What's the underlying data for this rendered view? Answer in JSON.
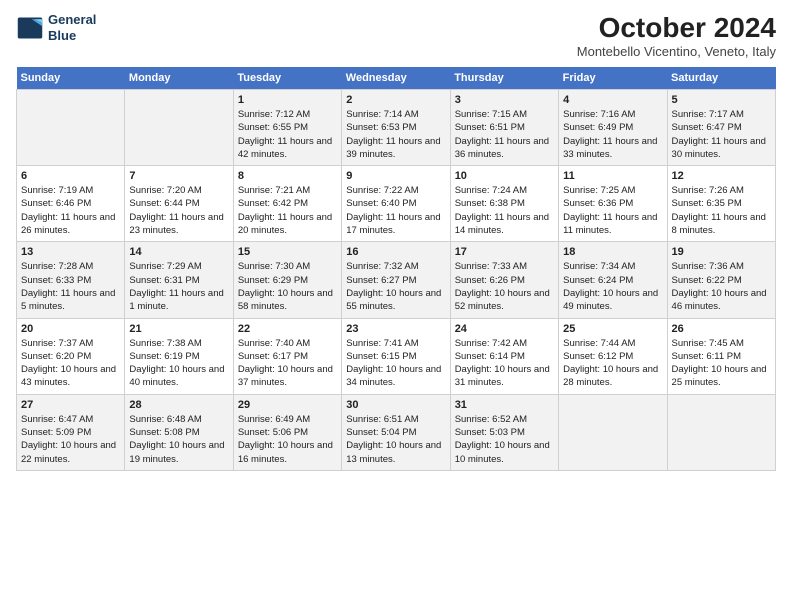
{
  "header": {
    "logo_line1": "General",
    "logo_line2": "Blue",
    "month": "October 2024",
    "location": "Montebello Vicentino, Veneto, Italy"
  },
  "days_of_week": [
    "Sunday",
    "Monday",
    "Tuesday",
    "Wednesday",
    "Thursday",
    "Friday",
    "Saturday"
  ],
  "weeks": [
    [
      {
        "day": "",
        "sunrise": "",
        "sunset": "",
        "daylight": ""
      },
      {
        "day": "",
        "sunrise": "",
        "sunset": "",
        "daylight": ""
      },
      {
        "day": "1",
        "sunrise": "Sunrise: 7:12 AM",
        "sunset": "Sunset: 6:55 PM",
        "daylight": "Daylight: 11 hours and 42 minutes."
      },
      {
        "day": "2",
        "sunrise": "Sunrise: 7:14 AM",
        "sunset": "Sunset: 6:53 PM",
        "daylight": "Daylight: 11 hours and 39 minutes."
      },
      {
        "day": "3",
        "sunrise": "Sunrise: 7:15 AM",
        "sunset": "Sunset: 6:51 PM",
        "daylight": "Daylight: 11 hours and 36 minutes."
      },
      {
        "day": "4",
        "sunrise": "Sunrise: 7:16 AM",
        "sunset": "Sunset: 6:49 PM",
        "daylight": "Daylight: 11 hours and 33 minutes."
      },
      {
        "day": "5",
        "sunrise": "Sunrise: 7:17 AM",
        "sunset": "Sunset: 6:47 PM",
        "daylight": "Daylight: 11 hours and 30 minutes."
      }
    ],
    [
      {
        "day": "6",
        "sunrise": "Sunrise: 7:19 AM",
        "sunset": "Sunset: 6:46 PM",
        "daylight": "Daylight: 11 hours and 26 minutes."
      },
      {
        "day": "7",
        "sunrise": "Sunrise: 7:20 AM",
        "sunset": "Sunset: 6:44 PM",
        "daylight": "Daylight: 11 hours and 23 minutes."
      },
      {
        "day": "8",
        "sunrise": "Sunrise: 7:21 AM",
        "sunset": "Sunset: 6:42 PM",
        "daylight": "Daylight: 11 hours and 20 minutes."
      },
      {
        "day": "9",
        "sunrise": "Sunrise: 7:22 AM",
        "sunset": "Sunset: 6:40 PM",
        "daylight": "Daylight: 11 hours and 17 minutes."
      },
      {
        "day": "10",
        "sunrise": "Sunrise: 7:24 AM",
        "sunset": "Sunset: 6:38 PM",
        "daylight": "Daylight: 11 hours and 14 minutes."
      },
      {
        "day": "11",
        "sunrise": "Sunrise: 7:25 AM",
        "sunset": "Sunset: 6:36 PM",
        "daylight": "Daylight: 11 hours and 11 minutes."
      },
      {
        "day": "12",
        "sunrise": "Sunrise: 7:26 AM",
        "sunset": "Sunset: 6:35 PM",
        "daylight": "Daylight: 11 hours and 8 minutes."
      }
    ],
    [
      {
        "day": "13",
        "sunrise": "Sunrise: 7:28 AM",
        "sunset": "Sunset: 6:33 PM",
        "daylight": "Daylight: 11 hours and 5 minutes."
      },
      {
        "day": "14",
        "sunrise": "Sunrise: 7:29 AM",
        "sunset": "Sunset: 6:31 PM",
        "daylight": "Daylight: 11 hours and 1 minute."
      },
      {
        "day": "15",
        "sunrise": "Sunrise: 7:30 AM",
        "sunset": "Sunset: 6:29 PM",
        "daylight": "Daylight: 10 hours and 58 minutes."
      },
      {
        "day": "16",
        "sunrise": "Sunrise: 7:32 AM",
        "sunset": "Sunset: 6:27 PM",
        "daylight": "Daylight: 10 hours and 55 minutes."
      },
      {
        "day": "17",
        "sunrise": "Sunrise: 7:33 AM",
        "sunset": "Sunset: 6:26 PM",
        "daylight": "Daylight: 10 hours and 52 minutes."
      },
      {
        "day": "18",
        "sunrise": "Sunrise: 7:34 AM",
        "sunset": "Sunset: 6:24 PM",
        "daylight": "Daylight: 10 hours and 49 minutes."
      },
      {
        "day": "19",
        "sunrise": "Sunrise: 7:36 AM",
        "sunset": "Sunset: 6:22 PM",
        "daylight": "Daylight: 10 hours and 46 minutes."
      }
    ],
    [
      {
        "day": "20",
        "sunrise": "Sunrise: 7:37 AM",
        "sunset": "Sunset: 6:20 PM",
        "daylight": "Daylight: 10 hours and 43 minutes."
      },
      {
        "day": "21",
        "sunrise": "Sunrise: 7:38 AM",
        "sunset": "Sunset: 6:19 PM",
        "daylight": "Daylight: 10 hours and 40 minutes."
      },
      {
        "day": "22",
        "sunrise": "Sunrise: 7:40 AM",
        "sunset": "Sunset: 6:17 PM",
        "daylight": "Daylight: 10 hours and 37 minutes."
      },
      {
        "day": "23",
        "sunrise": "Sunrise: 7:41 AM",
        "sunset": "Sunset: 6:15 PM",
        "daylight": "Daylight: 10 hours and 34 minutes."
      },
      {
        "day": "24",
        "sunrise": "Sunrise: 7:42 AM",
        "sunset": "Sunset: 6:14 PM",
        "daylight": "Daylight: 10 hours and 31 minutes."
      },
      {
        "day": "25",
        "sunrise": "Sunrise: 7:44 AM",
        "sunset": "Sunset: 6:12 PM",
        "daylight": "Daylight: 10 hours and 28 minutes."
      },
      {
        "day": "26",
        "sunrise": "Sunrise: 7:45 AM",
        "sunset": "Sunset: 6:11 PM",
        "daylight": "Daylight: 10 hours and 25 minutes."
      }
    ],
    [
      {
        "day": "27",
        "sunrise": "Sunrise: 6:47 AM",
        "sunset": "Sunset: 5:09 PM",
        "daylight": "Daylight: 10 hours and 22 minutes."
      },
      {
        "day": "28",
        "sunrise": "Sunrise: 6:48 AM",
        "sunset": "Sunset: 5:08 PM",
        "daylight": "Daylight: 10 hours and 19 minutes."
      },
      {
        "day": "29",
        "sunrise": "Sunrise: 6:49 AM",
        "sunset": "Sunset: 5:06 PM",
        "daylight": "Daylight: 10 hours and 16 minutes."
      },
      {
        "day": "30",
        "sunrise": "Sunrise: 6:51 AM",
        "sunset": "Sunset: 5:04 PM",
        "daylight": "Daylight: 10 hours and 13 minutes."
      },
      {
        "day": "31",
        "sunrise": "Sunrise: 6:52 AM",
        "sunset": "Sunset: 5:03 PM",
        "daylight": "Daylight: 10 hours and 10 minutes."
      },
      {
        "day": "",
        "sunrise": "",
        "sunset": "",
        "daylight": ""
      },
      {
        "day": "",
        "sunrise": "",
        "sunset": "",
        "daylight": ""
      }
    ]
  ]
}
